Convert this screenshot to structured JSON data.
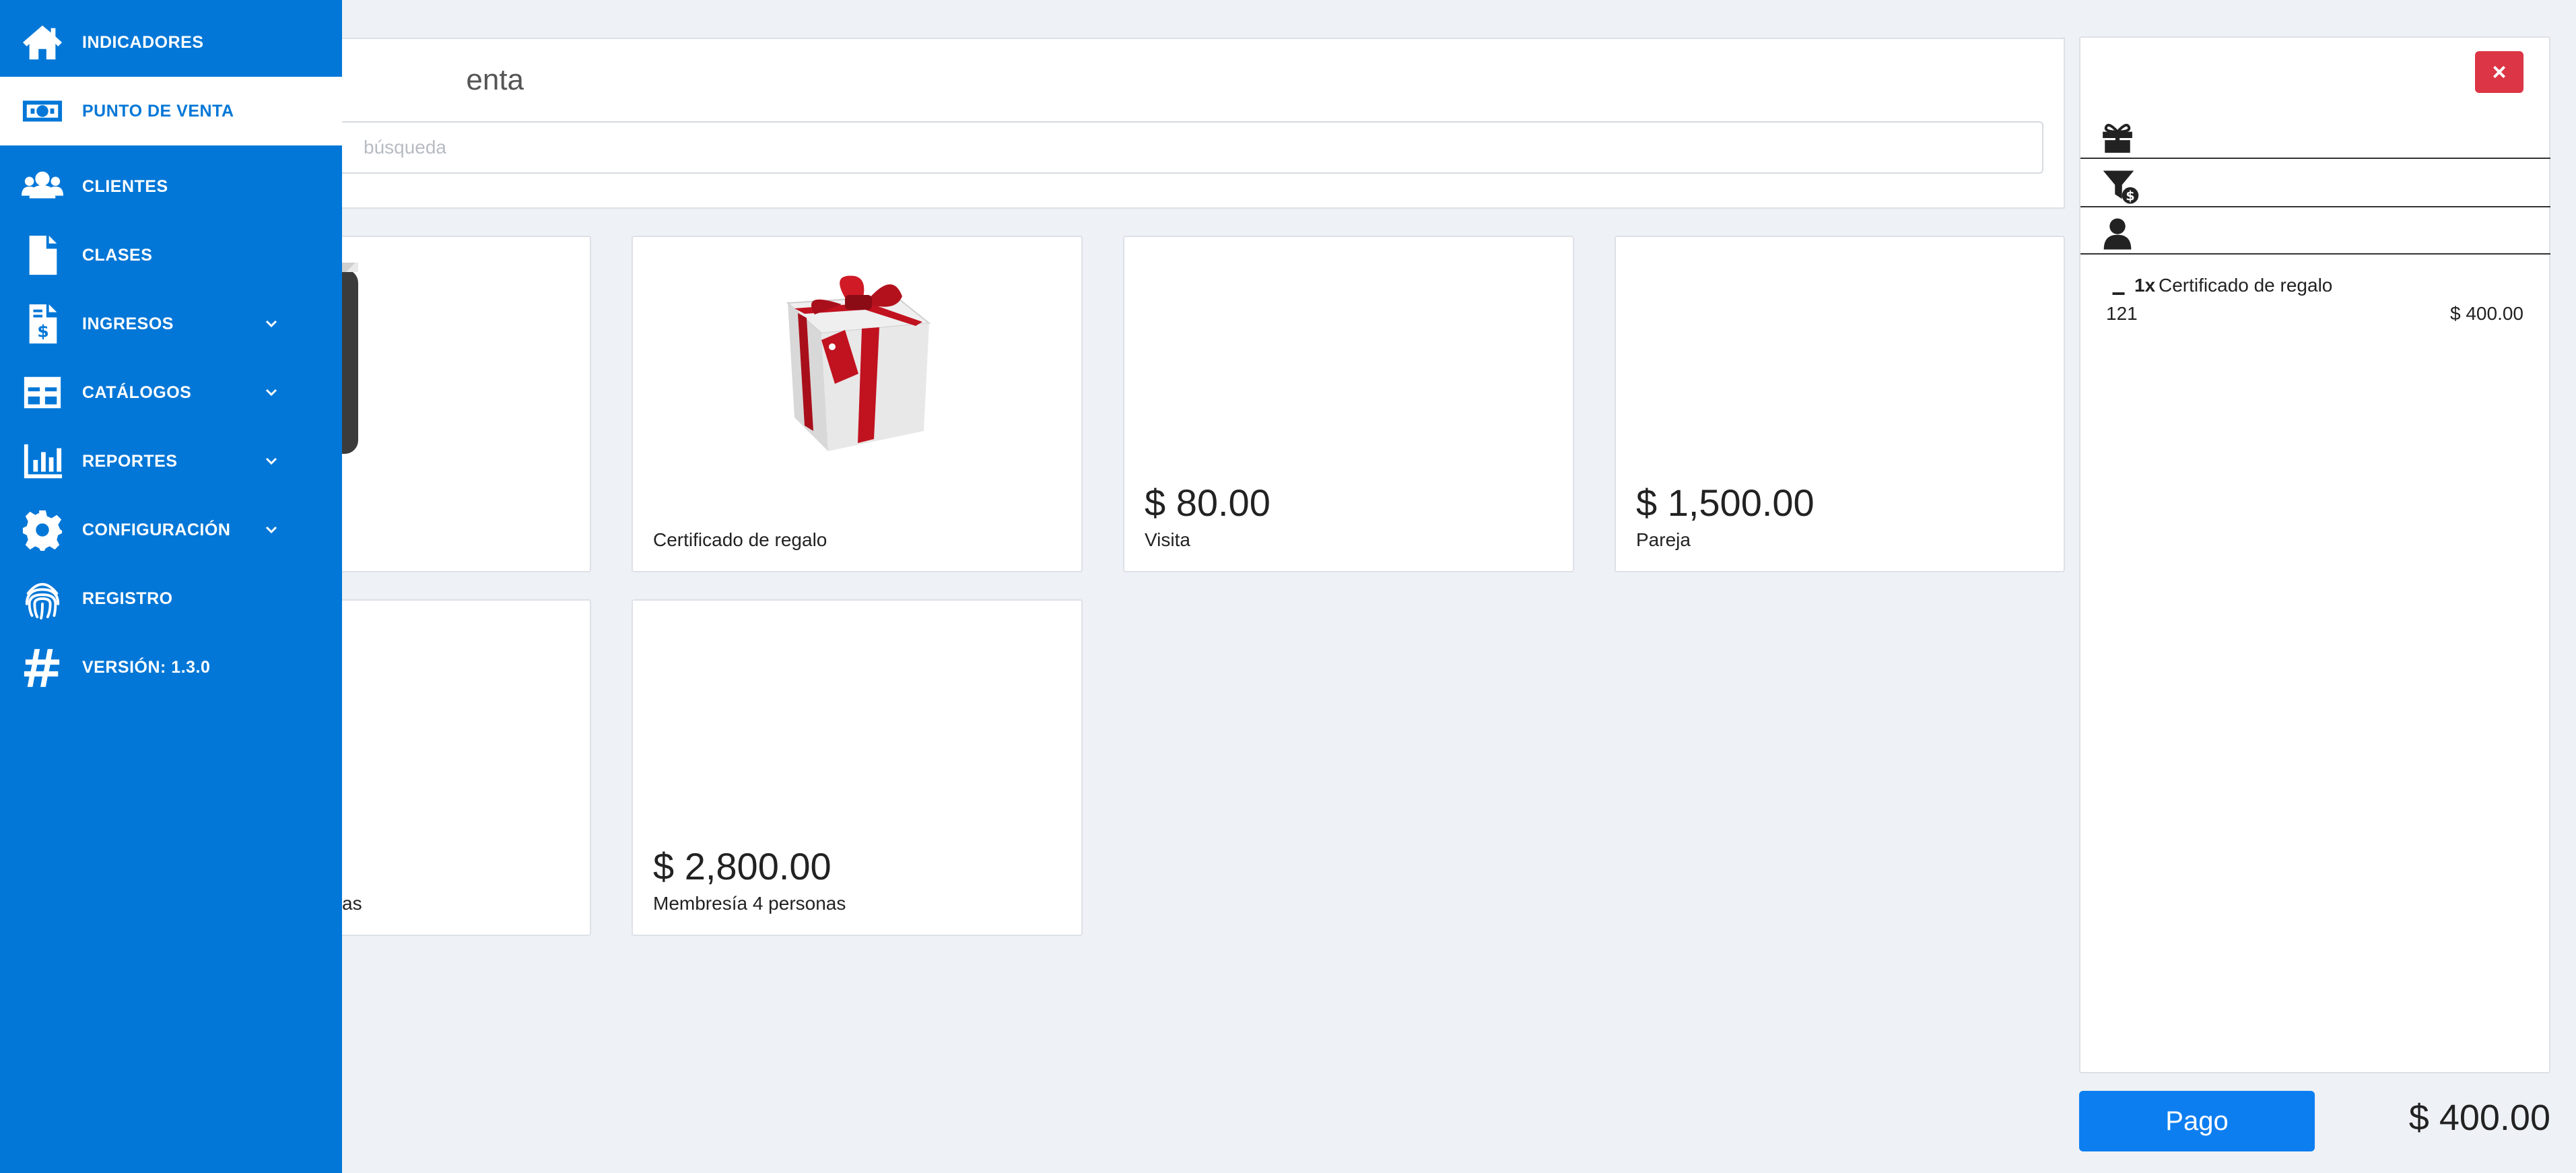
{
  "sidebar": {
    "items": [
      {
        "label": "INDICADORES",
        "icon": "home-icon"
      },
      {
        "label": "PUNTO DE VENTA",
        "icon": "money-bill-icon"
      },
      {
        "label": "CLIENTES",
        "icon": "users-icon"
      },
      {
        "label": "CLASES",
        "icon": "file-icon"
      },
      {
        "label": "INGRESOS",
        "icon": "invoice-dollar-icon"
      },
      {
        "label": "CATÁLOGOS",
        "icon": "table-icon"
      },
      {
        "label": "REPORTES",
        "icon": "bar-chart-icon"
      },
      {
        "label": "CONFIGURACIÓN",
        "icon": "gear-icon"
      },
      {
        "label": "REGISTRO",
        "icon": "fingerprint-icon"
      },
      {
        "label": "VERSIÓN: 1.3.0",
        "icon": "hashtag-icon"
      }
    ]
  },
  "main": {
    "title_visible": "enta",
    "search_placeholder": "búsqueda"
  },
  "products": [
    {
      "price": "",
      "name": "",
      "image": "receipt-icon"
    },
    {
      "price": "",
      "name": "Certificado de regalo",
      "image": "gift-box-icon"
    },
    {
      "price": "$ 80.00",
      "name": "Visita"
    },
    {
      "price": "$ 1,500.00",
      "name": "Pareja"
    },
    {
      "price": "",
      "name": "as"
    },
    {
      "price": "$ 2,800.00",
      "name": "Membresía 4 personas"
    }
  ],
  "cart": {
    "close_label": "×",
    "line": {
      "minus": "−",
      "qty": "1x",
      "name": "Certificado de regalo",
      "code": "121",
      "price": "$ 400.00"
    },
    "pay_label": "Pago",
    "total": "$ 400.00"
  },
  "colors": {
    "sidebar": "#0277d7",
    "pay_button": "#0d7ef0",
    "close_button": "#dc3545"
  }
}
